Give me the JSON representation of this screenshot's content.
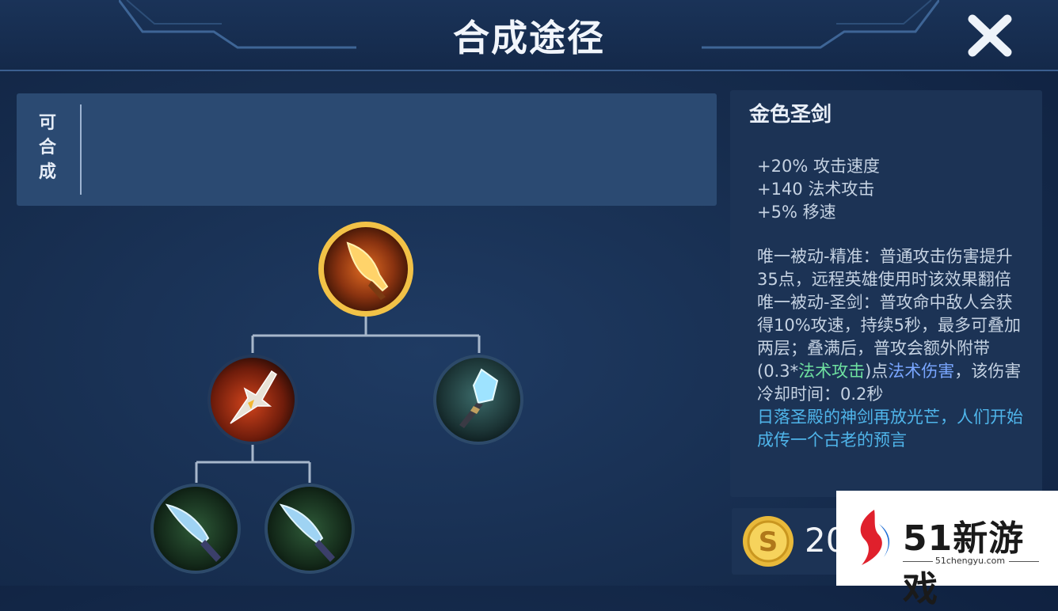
{
  "header": {
    "title": "合成途径"
  },
  "craftable": {
    "label": "可合成"
  },
  "tree": {
    "root": {
      "icon": "golden-sword-icon"
    },
    "children": [
      {
        "icon": "spear-icon"
      },
      {
        "icon": "crystal-staff-icon"
      }
    ],
    "grandchildren": [
      {
        "icon": "dagger-icon"
      },
      {
        "icon": "dagger-icon"
      }
    ]
  },
  "detail": {
    "name": "金色圣剑",
    "stats": [
      "+20% 攻击速度",
      "+140 法术攻击",
      "+5% 移速"
    ],
    "desc1": "唯一被动-精准：普通攻击伤害提升35点，远程英雄使用时该效果翻倍",
    "desc2": "唯一被动-圣剑：普攻命中敌人会获得10%攻速，持续5秒，最多可叠加两层；叠满后，普攻会额外附带(0.3*",
    "desc2_green": "法术攻击",
    "desc2_mid": ")点",
    "desc2_blue": "法术伤害",
    "desc2_end": "，该伤害冷却时间：0.2秒",
    "flavor": "日落圣殿的神剑再放光芒，人们开始成传一个古老的预言"
  },
  "price": {
    "value": "20",
    "icon": "gold-coin-icon"
  },
  "watermark": {
    "brand": "51新游戏",
    "url": "51chengyu.com",
    "icon": "51-logo-icon"
  },
  "colors": {
    "accent_green": "#6ee0a0",
    "accent_blue": "#79a6ff",
    "gold": "#e8b93a"
  }
}
